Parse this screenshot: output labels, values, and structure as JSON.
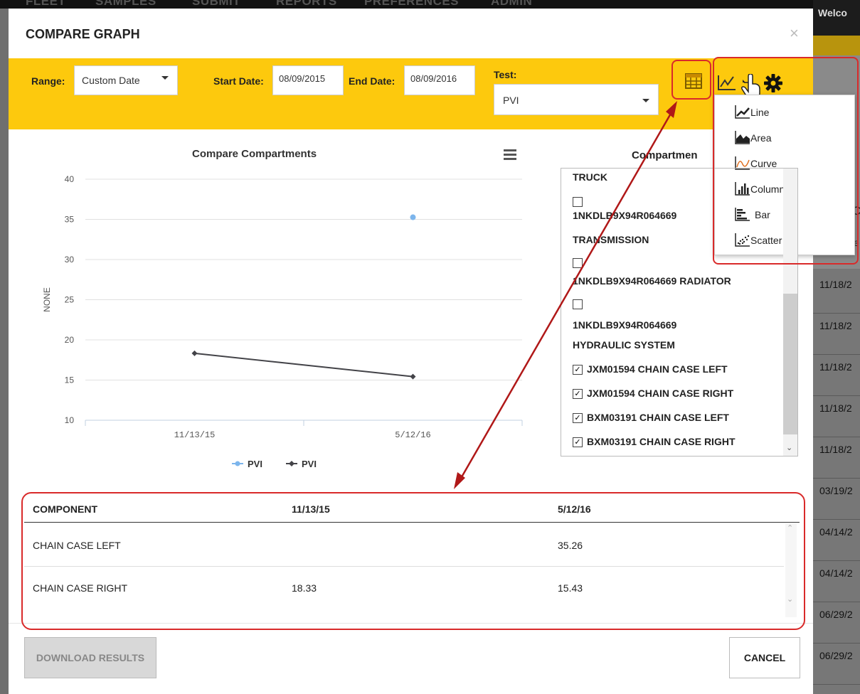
{
  "background": {
    "nav_items": [
      "FLEET",
      "SAMPLES",
      "SUBMIT",
      "REPORTS",
      "PREFERENCES",
      "ADMIN"
    ],
    "welcome": "Welco",
    "partial_letter_c": "C",
    "partial_letter_e": "e",
    "dates": [
      "11/18/2",
      "11/18/2",
      "11/18/2",
      "11/18/2",
      "11/18/2",
      "03/19/2",
      "04/14/2",
      "04/14/2",
      "06/29/2",
      "06/29/2"
    ]
  },
  "modal": {
    "title": "COMPARE GRAPH",
    "close": "×"
  },
  "toolbar": {
    "range_label": "Range:",
    "range_value": "Custom Date",
    "start_label": "Start Date:",
    "start_value": "08/09/2015",
    "end_label": "End Date:",
    "end_value": "08/09/2016",
    "test_label": "Test:",
    "test_value": "PVI"
  },
  "chart_menu": {
    "items": [
      "Line",
      "Area",
      "Curve",
      "Column",
      "Bar",
      "Scatter"
    ]
  },
  "chart_data": {
    "type": "line",
    "title": "Compare Compartments",
    "ylabel": "NONE",
    "xlabel": "",
    "categories": [
      "11/13/15",
      "5/12/16"
    ],
    "yticks": [
      "40",
      "35",
      "30",
      "25",
      "20",
      "15",
      "10"
    ],
    "ylim": [
      10,
      40
    ],
    "series": [
      {
        "name": "PVI",
        "values": [
          null,
          35.26
        ],
        "color": "#7cb5ec"
      },
      {
        "name": "PVI",
        "values": [
          18.33,
          15.43
        ],
        "color": "#434348"
      }
    ],
    "legend": [
      "PVI",
      "PVI"
    ],
    "legend_position": "bottom"
  },
  "compartments": {
    "title": "Compartmen",
    "items": [
      {
        "label": "TRUCK",
        "checkbox": "none"
      },
      {
        "label": "1NKDLB9X94R064669",
        "checkbox": "unchecked-above"
      },
      {
        "label": "TRANSMISSION",
        "checkbox": "none"
      },
      {
        "label": "1NKDLB9X94R064669 RADIATOR",
        "checkbox": "unchecked-above"
      },
      {
        "label": "1NKDLB9X94R064669",
        "checkbox": "unchecked-above"
      },
      {
        "label": "HYDRAULIC SYSTEM",
        "checkbox": "none"
      },
      {
        "label": "JXM01594 CHAIN CASE LEFT",
        "checkbox": "checked"
      },
      {
        "label": "JXM01594 CHAIN CASE RIGHT",
        "checkbox": "checked"
      },
      {
        "label": "BXM03191 CHAIN CASE LEFT",
        "checkbox": "checked"
      },
      {
        "label": "BXM03191 CHAIN CASE RIGHT",
        "checkbox": "checked"
      }
    ]
  },
  "table": {
    "headers": [
      "COMPONENT",
      "11/13/15",
      "5/12/16"
    ],
    "rows": [
      [
        "CHAIN CASE LEFT",
        "",
        "35.26"
      ],
      [
        "CHAIN CASE RIGHT",
        "18.33",
        "15.43"
      ]
    ]
  },
  "footer": {
    "download_label": "DOWNLOAD RESULTS",
    "cancel_label": "CANCEL"
  },
  "colors": {
    "toolbar": "#fdc90d",
    "annotation": "#d92a2a"
  }
}
